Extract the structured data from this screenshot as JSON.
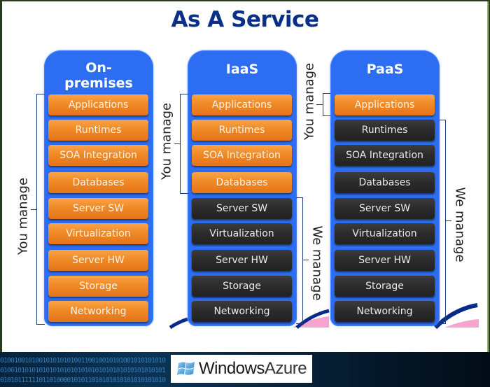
{
  "title": "As A Service",
  "columns": [
    {
      "name": "On-premises",
      "title_line1": "On-",
      "title_line2": "premises",
      "layers": [
        {
          "label": "Applications",
          "managed_by": "you"
        },
        {
          "label": "Runtimes",
          "managed_by": "you"
        },
        {
          "label": "SOA Integration",
          "managed_by": "you"
        },
        {
          "label": "Databases",
          "managed_by": "you"
        },
        {
          "label": "Server SW",
          "managed_by": "you"
        },
        {
          "label": "Virtualization",
          "managed_by": "you"
        },
        {
          "label": "Server HW",
          "managed_by": "you"
        },
        {
          "label": "Storage",
          "managed_by": "you"
        },
        {
          "label": "Networking",
          "managed_by": "you"
        }
      ],
      "you_manage_label": "You manage"
    },
    {
      "name": "IaaS",
      "title_line1": "IaaS",
      "layers": [
        {
          "label": "Applications",
          "managed_by": "you"
        },
        {
          "label": "Runtimes",
          "managed_by": "you"
        },
        {
          "label": "SOA Integration",
          "managed_by": "you"
        },
        {
          "label": "Databases",
          "managed_by": "you"
        },
        {
          "label": "Server SW",
          "managed_by": "we"
        },
        {
          "label": "Virtualization",
          "managed_by": "we"
        },
        {
          "label": "Server HW",
          "managed_by": "we"
        },
        {
          "label": "Storage",
          "managed_by": "we"
        },
        {
          "label": "Networking",
          "managed_by": "we"
        }
      ],
      "you_manage_label": "You manage",
      "we_manage_label": "We manage"
    },
    {
      "name": "PaaS",
      "title_line1": "PaaS",
      "layers": [
        {
          "label": "Applications",
          "managed_by": "you"
        },
        {
          "label": "Runtimes",
          "managed_by": "we"
        },
        {
          "label": "SOA Integration",
          "managed_by": "we"
        },
        {
          "label": "Databases",
          "managed_by": "we"
        },
        {
          "label": "Server SW",
          "managed_by": "we"
        },
        {
          "label": "Virtualization",
          "managed_by": "we"
        },
        {
          "label": "Server HW",
          "managed_by": "we"
        },
        {
          "label": "Storage",
          "managed_by": "we"
        },
        {
          "label": "Networking",
          "managed_by": "we"
        }
      ],
      "you_manage_label": "You manage",
      "we_manage_label": "We manage"
    }
  ],
  "colors": {
    "title": "#0a2f8a",
    "column_bg": "#2c6df2",
    "you_manage": "#f08a25",
    "we_manage": "#2b2b2b"
  },
  "footer": {
    "binary_lines": [
      "01001001010010101010100110010010101001010101010",
      "01001010101010101010101010101010101010101010101",
      "01010111111011010000101011010101010101010101010"
    ],
    "logo_word1": "Windows",
    "logo_word2": "Azure",
    "logo_icon": "windows-flag-icon"
  }
}
